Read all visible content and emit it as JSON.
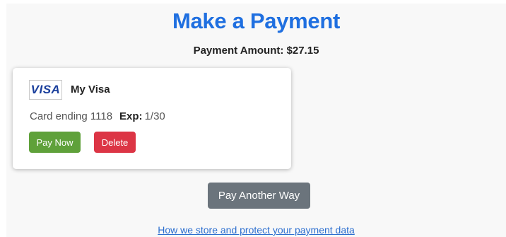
{
  "page": {
    "title": "Make a Payment",
    "amount_label": "Payment Amount: $27.15"
  },
  "card": {
    "logo_text": "VISA",
    "name": "My Visa",
    "ending_text": "Card ending 1118",
    "exp_label": "Exp:",
    "exp_value": "1/30",
    "pay_label": "Pay Now",
    "delete_label": "Delete"
  },
  "actions": {
    "other_way_label": "Pay Another Way",
    "privacy_link": "How we store and protect your payment data"
  },
  "colors": {
    "title": "#1f6fe0",
    "pay_button": "#5fa13a",
    "delete_button": "#dc3545",
    "other_button": "#6b747c",
    "link": "#2b6ecf",
    "background": "#f8f8f8"
  },
  "icons": {
    "card_brand": "visa-logo"
  }
}
